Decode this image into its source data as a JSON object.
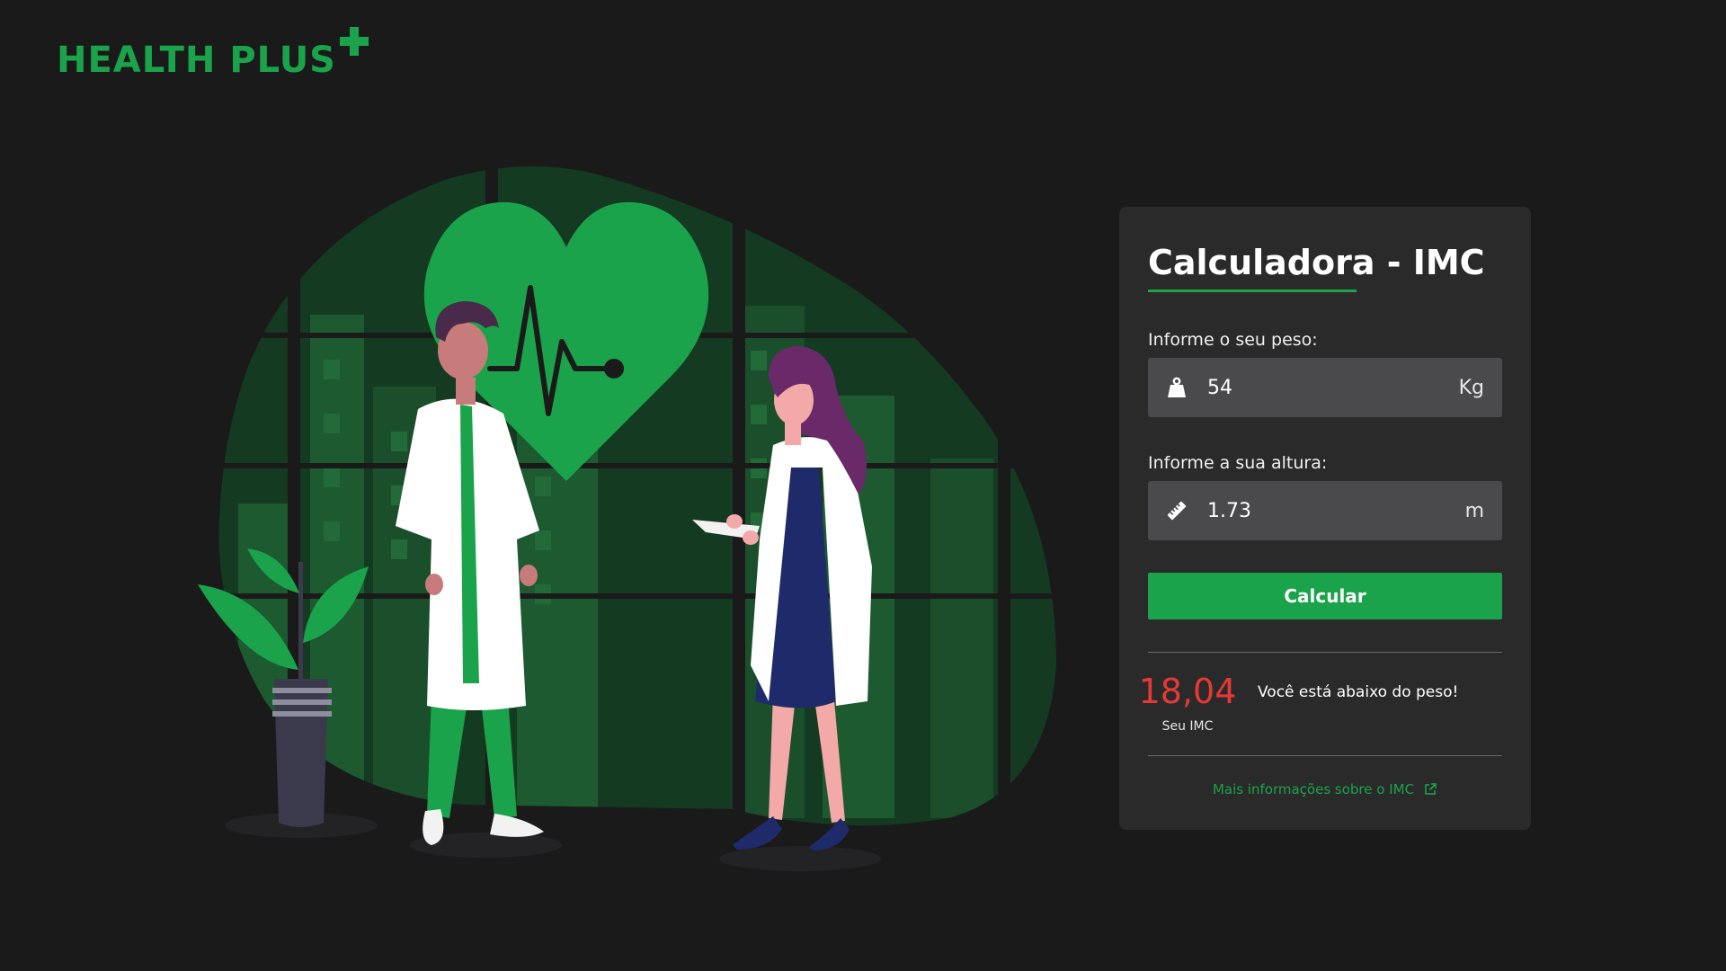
{
  "brand": {
    "name": "HEALTH PLUS",
    "accent_color": "#1aa34a"
  },
  "calculator": {
    "title": "Calculadora - IMC",
    "weight": {
      "label": "Informe o seu peso:",
      "value": "54",
      "unit": "Kg",
      "icon": "weight-icon"
    },
    "height": {
      "label": "Informe a sua altura:",
      "value": "1.73",
      "unit": "m",
      "icon": "ruler-icon"
    },
    "button_label": "Calcular",
    "result": {
      "value": "18,04",
      "caption": "Seu IMC",
      "message": "Você está abaixo do peso!",
      "value_color": "#e53935"
    },
    "more_info_link": "Mais informações sobre o IMC",
    "more_info_icon": "external-link-icon"
  },
  "colors": {
    "background": "#1a1a1b",
    "card": "#2a2a2b",
    "input": "#4a4a4c",
    "accent": "#1aa34a",
    "error": "#e53935"
  }
}
